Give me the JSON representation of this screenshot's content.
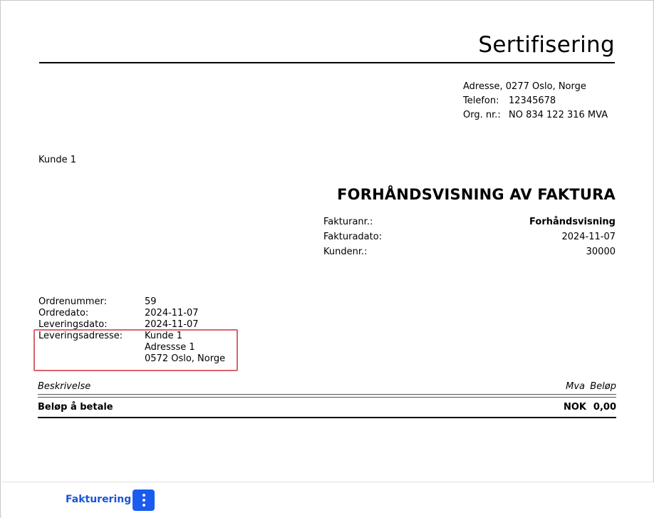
{
  "document": {
    "company_title": "Sertifisering",
    "company_info": {
      "address": "Adresse, 0277 Oslo, Norge",
      "phone_label": "Telefon:",
      "phone_value": "12345678",
      "org_label": "Org. nr.:",
      "org_value": "NO 834 122 316 MVA"
    },
    "customer_name": "Kunde 1",
    "title": "FORHÅNDSVISNING AV FAKTURA",
    "meta": [
      {
        "label": "Fakturanr.:",
        "value": "Forhåndsvisning"
      },
      {
        "label": "Fakturadato:",
        "value": "2024-11-07"
      },
      {
        "label": "Kundenr.:",
        "value": "30000"
      }
    ],
    "order": {
      "order_number_label": "Ordrenummer:",
      "order_number_value": "59",
      "order_date_label": "Ordredato:",
      "order_date_value": "2024-11-07",
      "delivery_date_label": "Leveringsdato:",
      "delivery_date_value": "2024-11-07",
      "delivery_address_label": "Leveringsadresse:",
      "delivery_address_lines": [
        "Kunde 1",
        "Adressse 1",
        "0572 Oslo, Norge"
      ]
    },
    "lines_header": {
      "description": "Beskrivelse",
      "vat": "Mva",
      "amount": "Beløp"
    },
    "total": {
      "label": "Beløp å betale",
      "currency": "NOK",
      "amount": "0,00"
    }
  },
  "footer": {
    "link_label": "Fakturering",
    "menu_icon": "more-vertical-icon"
  },
  "colors": {
    "accent": "#1a5bf0",
    "link": "#1a55d6",
    "highlight_border": "#d9646e"
  }
}
